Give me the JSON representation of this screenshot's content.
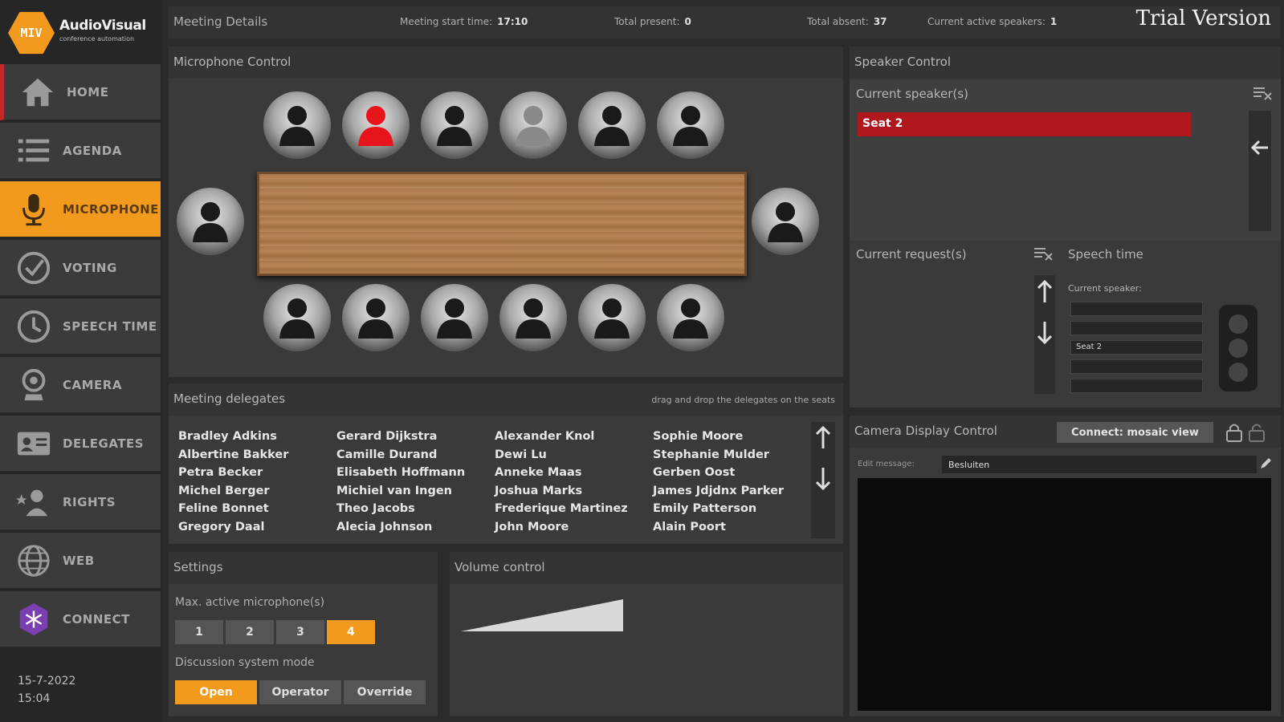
{
  "app": {
    "logo_text": "AudioVisual",
    "logo_sub": "conference automation",
    "logo_mark": "MIV",
    "date": "15-7-2022",
    "time": "15:04",
    "trial_label": "Trial Version"
  },
  "nav": [
    {
      "label": "HOME",
      "icon": "home-icon"
    },
    {
      "label": "AGENDA",
      "icon": "list-icon"
    },
    {
      "label": "MICROPHONE",
      "icon": "microphone-icon",
      "active": true
    },
    {
      "label": "VOTING",
      "icon": "check-circle-icon"
    },
    {
      "label": "SPEECH TIME",
      "icon": "clock-icon"
    },
    {
      "label": "CAMERA",
      "icon": "camera-icon"
    },
    {
      "label": "DELEGATES",
      "icon": "id-card-icon"
    },
    {
      "label": "RIGHTS",
      "icon": "user-star-icon"
    },
    {
      "label": "WEB",
      "icon": "globe-icon"
    },
    {
      "label": "CONNECT",
      "icon": "connect-icon"
    }
  ],
  "topbar": {
    "title": "Meeting Details",
    "start_label": "Meeting start time:",
    "start_value": "17:10",
    "present_label": "Total present:",
    "present_value": "0",
    "absent_label": "Total absent:",
    "absent_value": "37",
    "active_label": "Current active speakers:",
    "active_value": "1"
  },
  "mic_panel": {
    "title": "Microphone Control",
    "seats": [
      {
        "state": "idle"
      },
      {
        "state": "speaking"
      },
      {
        "state": "idle"
      },
      {
        "state": "disabled"
      },
      {
        "state": "idle"
      },
      {
        "state": "idle"
      },
      {
        "state": "idle"
      },
      {
        "state": "idle"
      },
      {
        "state": "idle"
      },
      {
        "state": "idle"
      },
      {
        "state": "idle"
      },
      {
        "state": "idle"
      },
      {
        "state": "idle"
      },
      {
        "state": "idle"
      }
    ]
  },
  "delegates": {
    "title": "Meeting delegates",
    "hint": "drag and drop the delegates on the seats",
    "columns": [
      [
        "Bradley Adkins",
        "Albertine Bakker",
        "Petra Becker",
        "Michel Berger",
        "Feline Bonnet",
        "Gregory Daal"
      ],
      [
        "Gerard Dijkstra",
        "Camille Durand",
        "Elisabeth Hoffmann",
        "Michiel van Ingen",
        "Theo Jacobs",
        "Alecia Johnson"
      ],
      [
        "Alexander Knol",
        "Dewi Lu",
        "Anneke Maas",
        "Joshua Marks",
        "Frederique Martinez",
        "John Moore"
      ],
      [
        "Sophie Moore",
        "Stephanie Mulder",
        "Gerben Oost",
        "James Jdjdnx Parker",
        "Emily Patterson",
        "Alain Poort"
      ]
    ]
  },
  "settings": {
    "title": "Settings",
    "max_mics_label": "Max. active microphone(s)",
    "max_mics_options": [
      "1",
      "2",
      "3",
      "4"
    ],
    "max_mics_selected": "4",
    "mode_label": "Discussion system mode",
    "mode_options": [
      "Open",
      "Operator",
      "Override"
    ],
    "mode_selected": "Open"
  },
  "volume": {
    "title": "Volume control",
    "level": 1.0
  },
  "speaker": {
    "title": "Speaker Control",
    "current_label": "Current speaker(s)",
    "current_speakers": [
      "Seat 2"
    ],
    "requests_label": "Current request(s)",
    "speech_time_label": "Speech time",
    "current_speaker_label": "Current speaker:",
    "time_rows": [
      "",
      "",
      "Seat 2",
      "",
      ""
    ]
  },
  "camera": {
    "title": "Camera Display Control",
    "connect_button": "Connect: mosaic view",
    "edit_label": "Edit message:",
    "edit_value": "Besluiten"
  },
  "colors": {
    "accent": "#f29a1d",
    "speaking": "#e8141c",
    "current_speaker_bar": "#b0171c"
  }
}
